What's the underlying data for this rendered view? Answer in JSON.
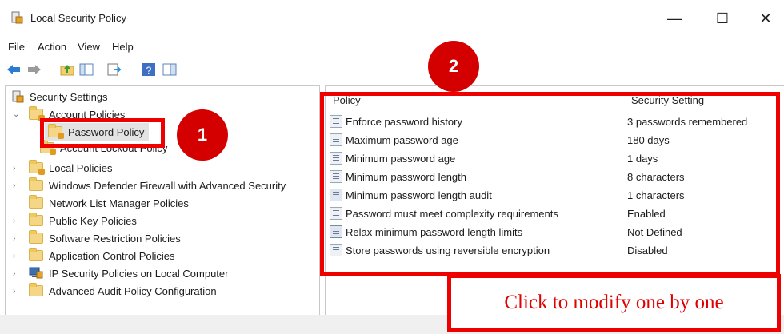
{
  "window": {
    "title": "Local Security Policy",
    "minimize": "—",
    "maximize": "☐",
    "close": "✕"
  },
  "menu": [
    "File",
    "Action",
    "View",
    "Help"
  ],
  "tree": {
    "root": "Security Settings",
    "account_policies": "Account Policies",
    "password_policy": "Password Policy",
    "account_lockout": "Account Lockout Policy",
    "items": [
      "Local Policies",
      "Windows Defender Firewall with Advanced Security",
      "Network List Manager Policies",
      "Public Key Policies",
      "Software Restriction Policies",
      "Application Control Policies",
      "IP Security Policies on Local Computer",
      "Advanced Audit Policy Configuration"
    ]
  },
  "list": {
    "col_policy": "Policy",
    "col_setting": "Security Setting",
    "rows": [
      {
        "name": "Enforce password history",
        "setting": "3 passwords remembered"
      },
      {
        "name": "Maximum password age",
        "setting": "180 days"
      },
      {
        "name": "Minimum password age",
        "setting": "1 days"
      },
      {
        "name": "Minimum password length",
        "setting": "8 characters"
      },
      {
        "name": "Minimum password length audit",
        "setting": "1 characters"
      },
      {
        "name": "Password must meet complexity requirements",
        "setting": "Enabled"
      },
      {
        "name": "Relax minimum password length limits",
        "setting": "Not Defined"
      },
      {
        "name": "Store passwords using reversible encryption",
        "setting": "Disabled"
      }
    ]
  },
  "annotations": {
    "badge1": "1",
    "badge2": "2",
    "note": "Click to modify one by one"
  },
  "colors": {
    "accent_red": "#ee0000",
    "badge_red": "#d40000"
  }
}
